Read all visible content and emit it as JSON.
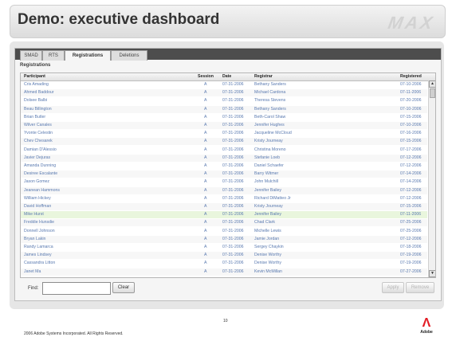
{
  "slide": {
    "title": "Demo: executive dashboard",
    "logo_text": "MAX",
    "footer": "2006 Adobe Systems Incorporated.  All Rights Reserved.",
    "page_number": "10",
    "brand": "Adobe"
  },
  "app": {
    "tabs": [
      {
        "label": "SMAD",
        "active": false
      },
      {
        "label": "RTS",
        "active": false
      },
      {
        "label": "Registrations",
        "active": true
      },
      {
        "label": "Deletions",
        "active": false
      }
    ],
    "section_title": "Registrations",
    "columns": [
      "Participant",
      "Session",
      "Date",
      "Registrar",
      "Registered"
    ],
    "rows": [
      [
        "Cris Amading",
        "A",
        "07-31-2006",
        "Bethany Sanders",
        "07-10-2006"
      ],
      [
        "Ahmed Baddour",
        "A",
        "07-31-2006",
        "Michael Cardona",
        "07-11-2006"
      ],
      [
        "Dolsee Balbi",
        "A",
        "07-31-2006",
        "Theresa Stevens",
        "07-20-2006"
      ],
      [
        "Beau Billington",
        "A",
        "07-31-2006",
        "Bethany Sanders",
        "07-10-2006"
      ],
      [
        "Brian Butler",
        "A",
        "07-31-2006",
        "Beth-Carol Shaw",
        "07-15-2006"
      ],
      [
        "Wilver Canales",
        "A",
        "07-31-2006",
        "Jennifer Hughes",
        "07-10-2006"
      ],
      [
        "Yvonte Celestin",
        "A",
        "07-31-2006",
        "Jacqueline McCloud",
        "07-16-2006"
      ],
      [
        "Chev Chesarek",
        "A",
        "07-31-2006",
        "Kristy Journeay",
        "07-15-2006"
      ],
      [
        "Damian D'Alessio",
        "A",
        "07-31-2006",
        "Christina Moreno",
        "07-17-2006"
      ],
      [
        "Javier Dejuras",
        "A",
        "07-31-2006",
        "Stefanie Loeb",
        "07-12-2006"
      ],
      [
        "Amanda Dunning",
        "A",
        "07-31-2006",
        "Daniel Schaefer",
        "07-12-2006"
      ],
      [
        "Desiree Escalante",
        "A",
        "07-31-2006",
        "Barry Witmer",
        "07-14-2006"
      ],
      [
        "Jason Gomez",
        "A",
        "07-31-2006",
        "John Mulchill",
        "07-14-2006"
      ],
      [
        "Jeanean Hammons",
        "A",
        "07-31-2006",
        "Jennifer Bailey",
        "07-12-2006"
      ],
      [
        "William Hickey",
        "A",
        "07-31-2006",
        "Richard DiMatteo Jr",
        "07-12-2006"
      ],
      [
        "David Hoffman",
        "A",
        "07-31-2006",
        "Kristy Journeay",
        "07-15-2006"
      ],
      [
        "Mike Hurst",
        "A",
        "07-31-2006",
        "Jennifer Bailey",
        "07-11-2006"
      ],
      [
        "Freddie Hunsdie",
        "A",
        "07-31-2006",
        "Chad Clark",
        "07-25-2006"
      ],
      [
        "Donnell Johnson",
        "A",
        "07-31-2006",
        "Michelle Lewis",
        "07-25-2006"
      ],
      [
        "Bryan Lakin",
        "A",
        "07-31-2006",
        "Jamie Jordan",
        "07-12-2006"
      ],
      [
        "Randy Lamarca",
        "A",
        "07-31-2006",
        "Sergey Chaykin",
        "07-18-2006"
      ],
      [
        "James Lindsey",
        "A",
        "07-31-2006",
        "Denise Worthy",
        "07-19-2006"
      ],
      [
        "Cassandra Litton",
        "A",
        "07-31-2006",
        "Denise Worthy",
        "07-19-2006"
      ],
      [
        "Janet Ma",
        "A",
        "07-31-2006",
        "Kevin McMillan",
        "07-27-2006"
      ]
    ],
    "selected_row": 16,
    "find_label": "Find:",
    "find_value": "",
    "clear_label": "Clear",
    "apply_label": "Apply",
    "remove_label": "Remove"
  }
}
